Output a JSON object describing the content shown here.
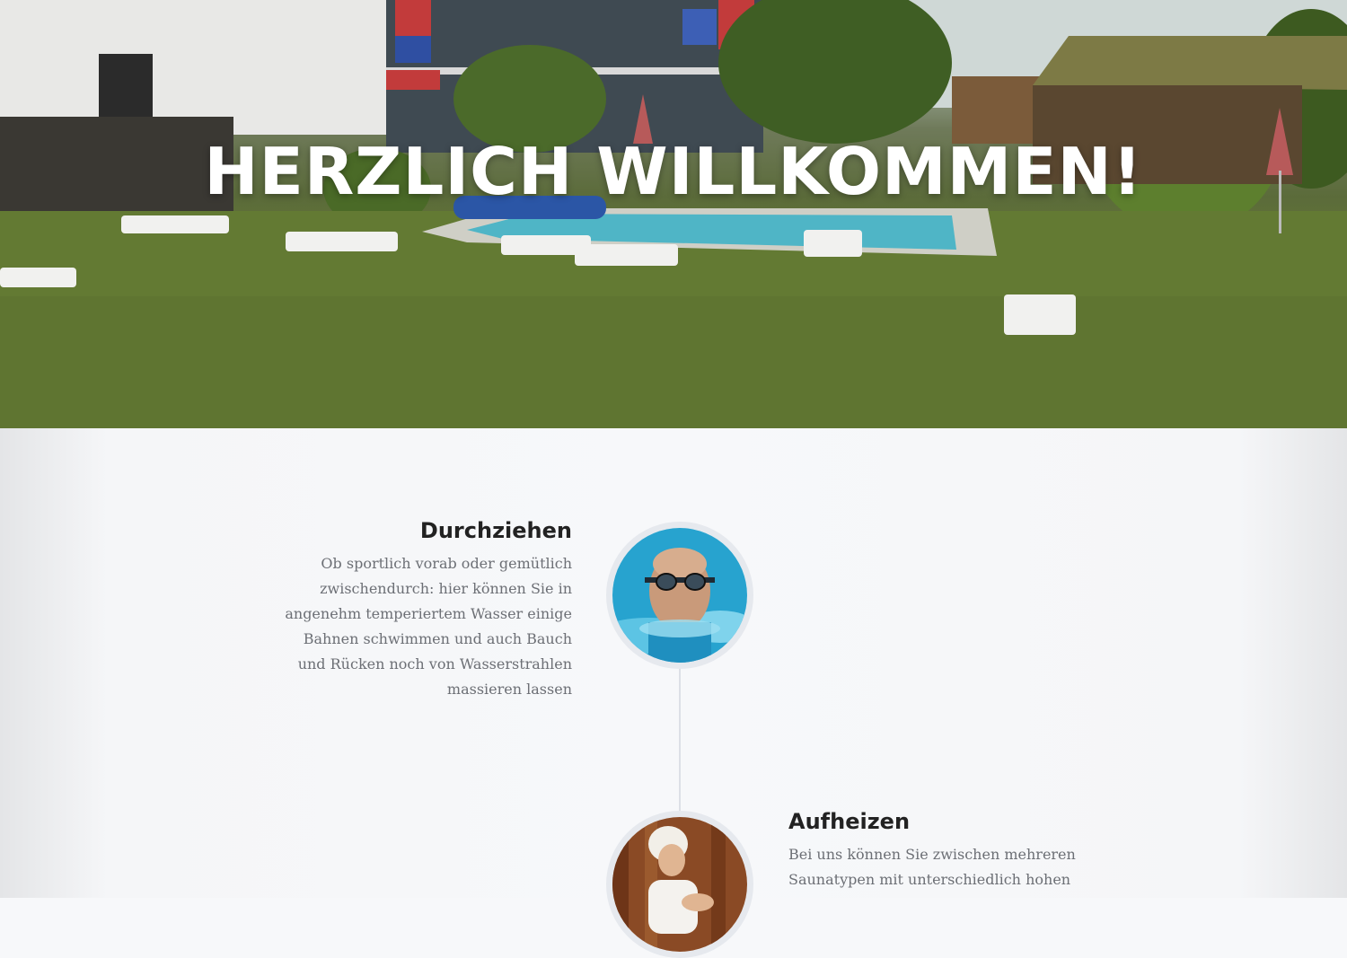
{
  "hero": {
    "title": "HERZLICH WILLKOMMEN!",
    "image": "outdoor-pool-garden-photo"
  },
  "features": [
    {
      "title": "Durchziehen",
      "text": "Ob sportlich vorab oder gemütlich zwischendurch: hier können Sie in angenehm temperiertem Wasser einige Bahnen schwimmen und auch Bauch und Rücken noch von Wasserstrahlen massieren lassen",
      "image": "swimmer-photo",
      "side": "left"
    },
    {
      "title": "Aufheizen",
      "text": "Bei uns können Sie zwischen mehreren Saunatypen mit unterschiedlich hohen",
      "image": "sauna-woman-photo",
      "side": "right"
    }
  ],
  "colors": {
    "heading": "#222222",
    "body_text": "#6c6f75",
    "background": "#f7f8fa",
    "avatar_border": "#e6e9ee",
    "timeline": "#dde0e6"
  }
}
